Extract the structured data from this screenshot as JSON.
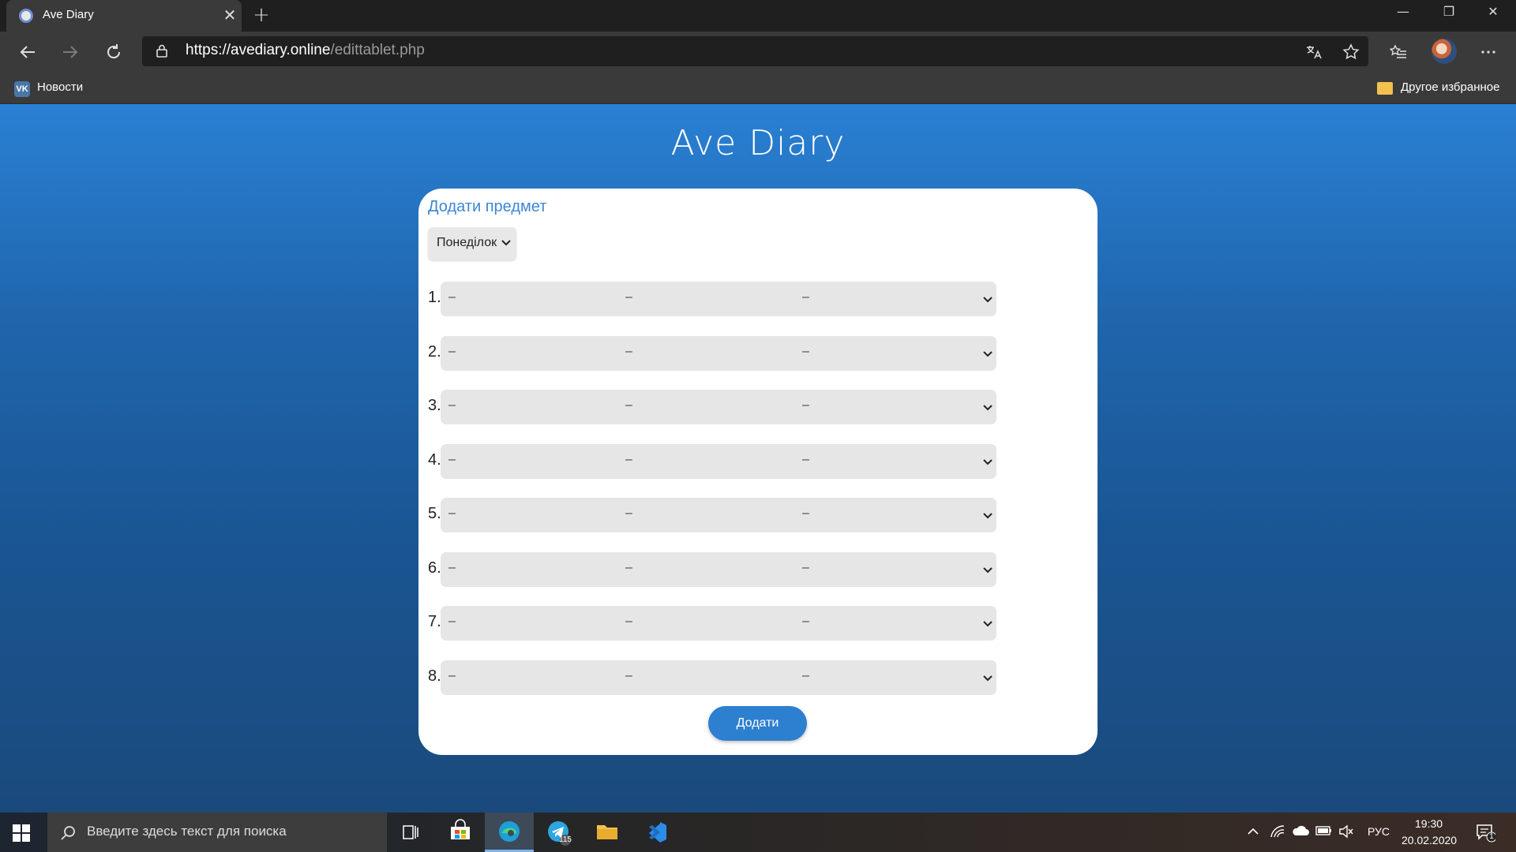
{
  "browser": {
    "tab_title": "Ave Diary",
    "tab_close": "✕",
    "new_tab": "+",
    "url_host": "https://avediary.online",
    "url_path": "/edittablet.php",
    "window_controls": [
      "—",
      "❐",
      "✕"
    ],
    "bookmarks": [
      {
        "label": "Новости",
        "icon": "vk-icon",
        "icon_text": "VK"
      }
    ],
    "other_bookmarks": "Другое избранное"
  },
  "page": {
    "site_title": "Ave Diary",
    "card_heading": "Додати предмет",
    "day_selected": "Понеділок",
    "lessons": [
      {
        "num": "1.",
        "values": [
          "–",
          "–",
          "–"
        ]
      },
      {
        "num": "2.",
        "values": [
          "–",
          "–",
          "–"
        ]
      },
      {
        "num": "3.",
        "values": [
          "–",
          "–",
          "–"
        ]
      },
      {
        "num": "4.",
        "values": [
          "–",
          "–",
          "–"
        ]
      },
      {
        "num": "5.",
        "values": [
          "–",
          "–",
          "–"
        ]
      },
      {
        "num": "6.",
        "values": [
          "–",
          "–",
          "–"
        ]
      },
      {
        "num": "7.",
        "values": [
          "–",
          "–",
          "–"
        ]
      },
      {
        "num": "8.",
        "values": [
          "–",
          "–",
          "–"
        ]
      }
    ],
    "separator": "/",
    "submit_label": "Додати"
  },
  "taskbar": {
    "search_placeholder": "Введите здесь текст для поиска",
    "telegram_badge": "115",
    "language": "РУС",
    "time": "19:30",
    "date": "20.02.2020",
    "notification_count": "1"
  },
  "colors": {
    "accent": "#2d7fd0",
    "heading": "#3c86d4",
    "page_top": "#2a80d4",
    "page_bottom": "#1a4a7c"
  }
}
